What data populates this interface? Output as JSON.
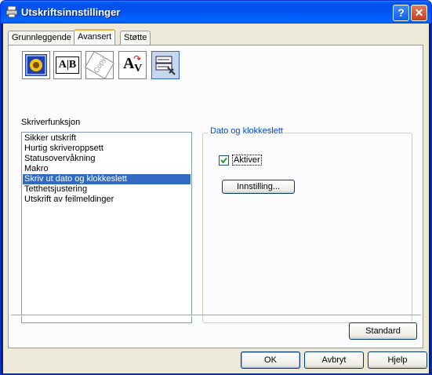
{
  "window": {
    "title": "Utskriftsinnstillinger"
  },
  "tabs": [
    {
      "label": "Grunnleggende"
    },
    {
      "label": "Avansert"
    },
    {
      "label": "Støtte"
    }
  ],
  "toolbar_icons": [
    "quality-icon",
    "duplex-ab-icon",
    "watermark-copy-icon",
    "font-substitution-icon",
    "device-options-icon"
  ],
  "toolbar_icon_text": {
    "ab": "A|B",
    "watermark": "Copy",
    "font_big": "A",
    "font_small": "V"
  },
  "printer_functions": {
    "label": "Skriverfunksjon",
    "items": [
      "Sikker utskrift",
      "Hurtig skriveroppsett",
      "Statusovervåkning",
      "Makro",
      "Skriv ut dato og klokkeslett",
      "Tetthetsjustering",
      "Utskrift av feilmeldinger"
    ],
    "selected_index": 4
  },
  "date_time_group": {
    "title": "Dato og klokkeslett",
    "enable_label": "Aktiver",
    "enable_checked": true,
    "settings_button": "Innstilling..."
  },
  "buttons": {
    "standard": "Standard",
    "ok": "OK",
    "cancel": "Avbryt",
    "help": "Hjelp"
  },
  "title_buttons": {
    "help": "?",
    "close": "✕"
  },
  "colors": {
    "titlebar": "#0054e3",
    "selection": "#316ac5",
    "group_title": "#0046d5"
  }
}
